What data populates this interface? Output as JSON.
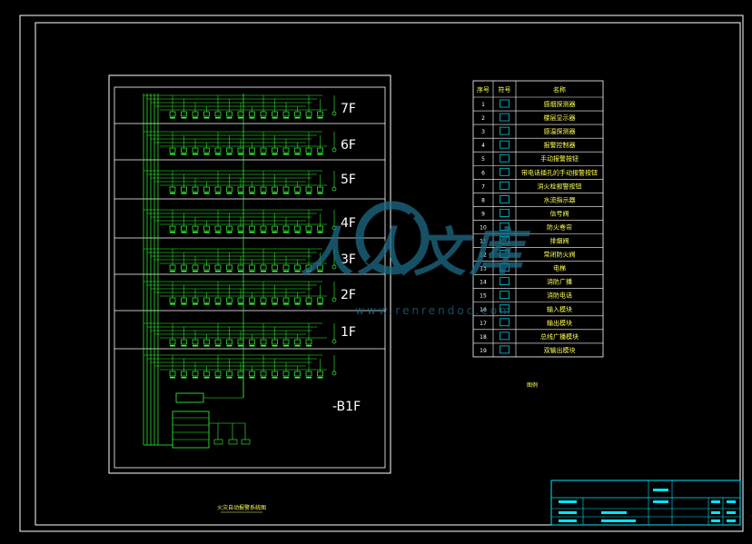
{
  "floors": [
    "7F",
    "6F",
    "5F",
    "4F",
    "3F",
    "2F",
    "1F",
    "-B1F"
  ],
  "legend": {
    "headers": [
      "序号",
      "符号",
      "名称"
    ],
    "rows": [
      {
        "no": "1",
        "name": "感烟探测器"
      },
      {
        "no": "2",
        "name": "楼层显示器"
      },
      {
        "no": "3",
        "name": "感温探测器"
      },
      {
        "no": "4",
        "name": "报警控制器"
      },
      {
        "no": "5",
        "name": "手动报警按钮"
      },
      {
        "no": "6",
        "name": "带电话插孔的手动报警按钮"
      },
      {
        "no": "7",
        "name": "消火栓报警按钮"
      },
      {
        "no": "8",
        "name": "水流指示器"
      },
      {
        "no": "9",
        "name": "信号阀"
      },
      {
        "no": "10",
        "name": "防火卷帘"
      },
      {
        "no": "11",
        "name": "排烟阀"
      },
      {
        "no": "12",
        "name": "常闭防火阀"
      },
      {
        "no": "13",
        "name": "电梯"
      },
      {
        "no": "14",
        "name": "消防广播"
      },
      {
        "no": "15",
        "name": "消防电话"
      },
      {
        "no": "16",
        "name": "输入模块"
      },
      {
        "no": "17",
        "name": "输出模块"
      },
      {
        "no": "18",
        "name": "总线广播模块"
      },
      {
        "no": "19",
        "name": "双输出模块"
      }
    ],
    "caption": "图例"
  },
  "drawing_title": "火灾自动报警系统图",
  "watermark": {
    "glyphs": "人人文库",
    "url": "www.renrendoc.com"
  },
  "colors": {
    "line": "#33ff33",
    "white": "#ffffff",
    "cyan": "#00e5ff",
    "watermark": "#1e6b86"
  }
}
